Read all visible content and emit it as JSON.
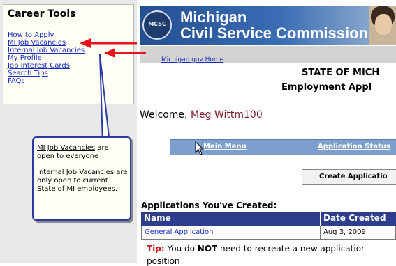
{
  "sidebar": {
    "title": "Career Tools",
    "links": [
      "How to Apply",
      "MI Job Vacancies",
      "Internal Job Vacancies",
      "My Profile",
      "Job Interest Cards",
      "Search Tips",
      "FAQs"
    ]
  },
  "callout": {
    "line1_link": "MI Job Vacancies",
    "line1_rest": " are open to everyone",
    "line2_link": "Internal Job Vacancies",
    "line2_rest": " are only open to current State of MI employees."
  },
  "banner": {
    "title_line1": "Michigan",
    "title_line2": "Civil Service Commission",
    "seal_label": "MCSC"
  },
  "home_link": "Michigan.gov Home",
  "page_title": "STATE OF MICH",
  "page_subtitle": "Employment Appl",
  "welcome": {
    "prefix": "Welcome, ",
    "name": "Meg Wittm100"
  },
  "nav": {
    "main_menu": "Main Menu",
    "application_status": "Application Status"
  },
  "create_button": "Create Applicatio",
  "applications": {
    "heading": "Applications You've Created:",
    "columns": [
      "Name",
      "Date Created"
    ],
    "rows": [
      {
        "name": "General Application",
        "date": "Aug 3, 2009"
      }
    ]
  },
  "tip": {
    "label": "Tip:",
    "text_before": " You do ",
    "emphasis": "NOT",
    "text_after": " need to recreate a new applicatior",
    "next_line": "position"
  },
  "colors": {
    "arrow": "#e8141e",
    "callout_border": "#2b3aa6",
    "table_header": "#2e3d8c",
    "nav_bar": "#7d9fce",
    "link": "#1a2dbd"
  }
}
